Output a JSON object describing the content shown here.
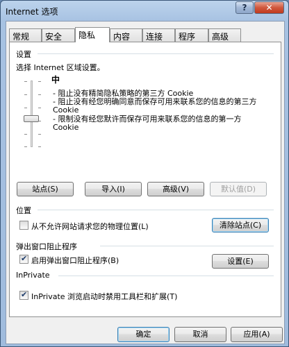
{
  "window": {
    "title": "Internet 选项",
    "help_label": "?",
    "close_label": "✕"
  },
  "tabs": [
    {
      "label": "常规"
    },
    {
      "label": "安全"
    },
    {
      "label": "隐私",
      "active": true
    },
    {
      "label": "内容"
    },
    {
      "label": "连接"
    },
    {
      "label": "程序"
    },
    {
      "label": "高级"
    }
  ],
  "settings": {
    "heading": "设置",
    "zone_hint": "选择 Internet 区域设置。",
    "level_name": "中",
    "slider_level": "3 of 6",
    "descriptions": [
      "- 阻止没有精简隐私策略的第三方 Cookie",
      "- 阻止没有经您明确同意而保存可用来联系您的信息的第三方 Cookie",
      "- 限制没有经您默许而保存可用来联系您的信息的第一方 Cookie"
    ],
    "buttons": {
      "sites": "站点(S)",
      "import": "导入(I)",
      "advanced": "高级(V)",
      "default": "默认值(D)"
    }
  },
  "location": {
    "heading": "位置",
    "checkbox_label": "从不允许网站请求您的物理位置(L)",
    "checked": false,
    "clear_button": "清除站点(C)"
  },
  "popup": {
    "heading": "弹出窗口阻止程序",
    "checkbox_label": "启用弹出窗口阻止程序(B)",
    "checked": true,
    "settings_button": "设置(E)"
  },
  "inprivate": {
    "heading": "InPrivate",
    "checkbox_label": "InPrivate 浏览启动时禁用工具栏和扩展(T)",
    "checked": true
  },
  "footer": {
    "ok": "确定",
    "cancel": "取消",
    "apply": "应用(A)"
  }
}
